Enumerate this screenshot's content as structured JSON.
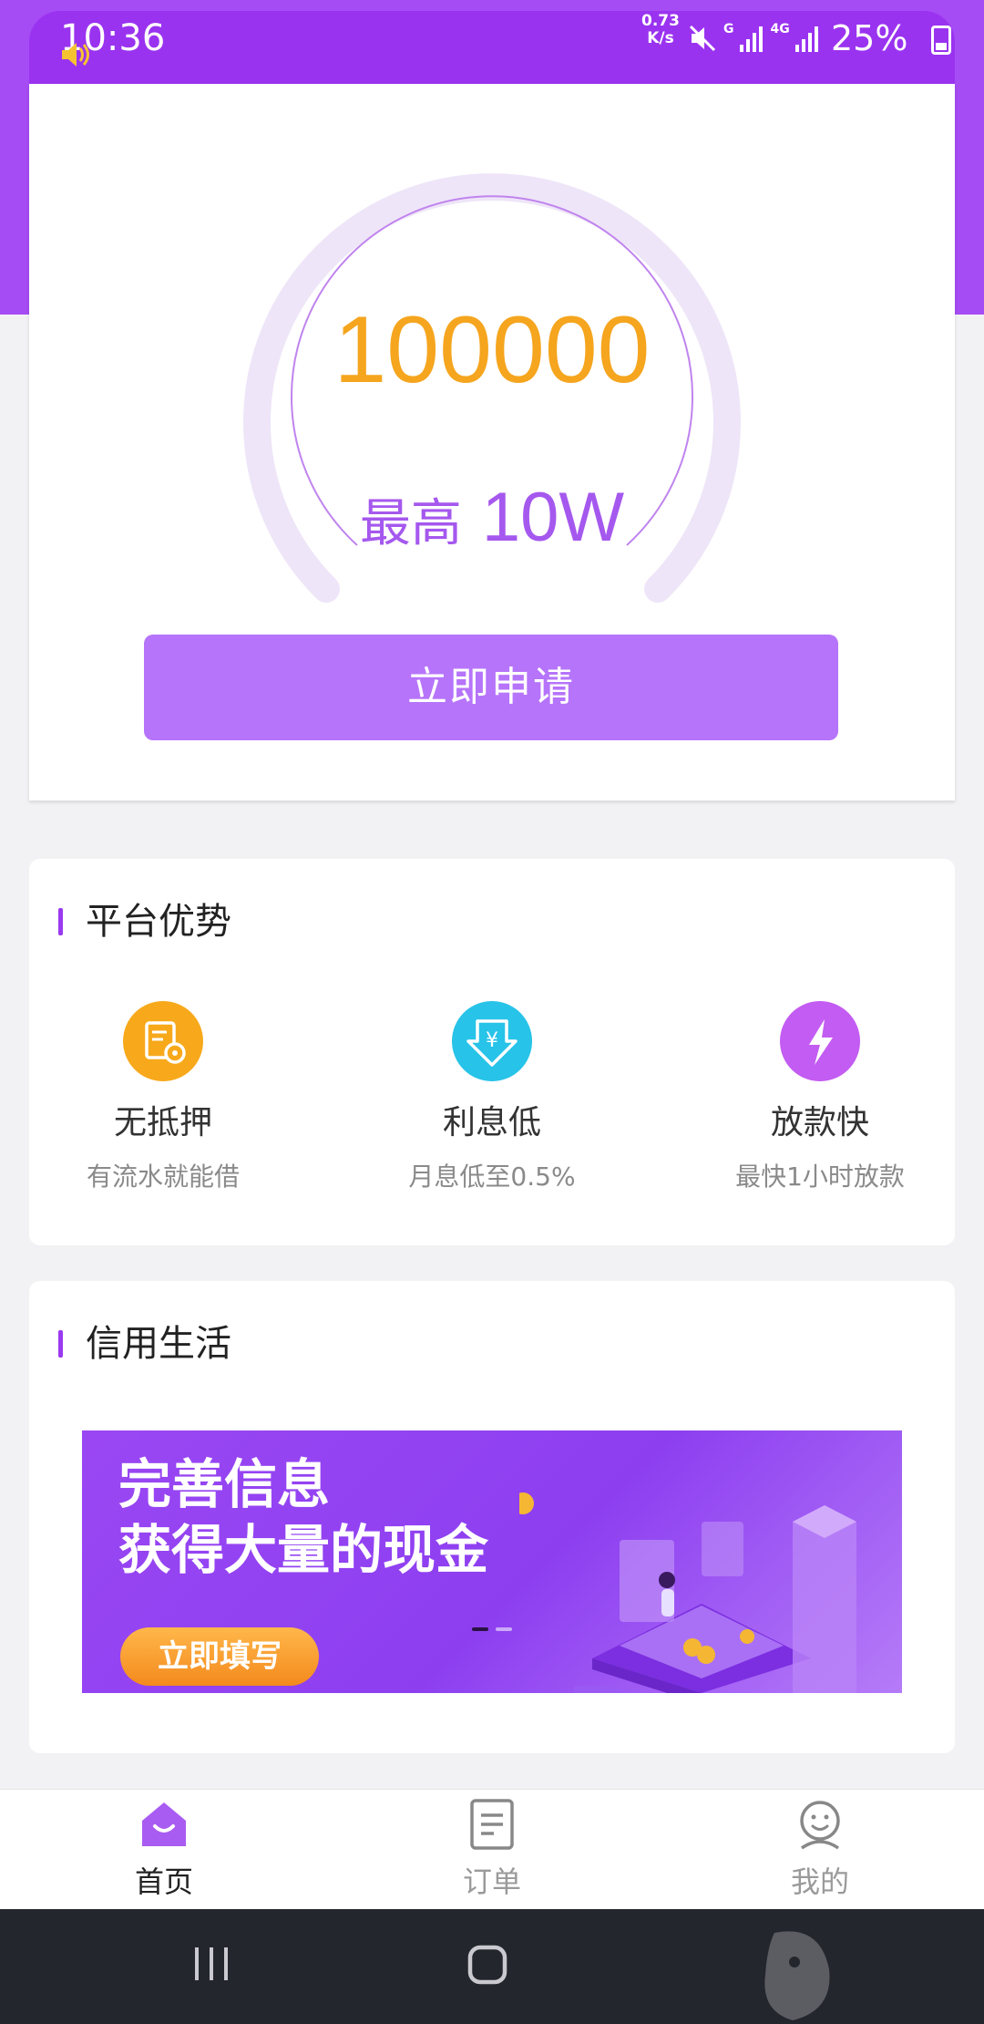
{
  "status_bar": {
    "time": "10:36",
    "net_speed_value": "0.73",
    "net_speed_unit": "K/s",
    "signal1_label": "G",
    "signal2_label": "4G",
    "battery": "25%"
  },
  "hero": {
    "amount": "100000",
    "max_label": "最高",
    "max_value": "10W",
    "apply_button": "立即申请"
  },
  "advantages": {
    "title": "平台优势",
    "items": [
      {
        "title": "无抵押",
        "subtitle": "有流水就能借",
        "icon": "document-seal-icon",
        "color": "#f7a91b"
      },
      {
        "title": "利息低",
        "subtitle": "月息低至0.5%",
        "icon": "yen-down-icon",
        "color": "#27c3e8"
      },
      {
        "title": "放款快",
        "subtitle": "最快1小时放款",
        "icon": "lightning-icon",
        "color": "#c35cf2"
      }
    ]
  },
  "credit_life": {
    "title": "信用生活",
    "banner": {
      "line1": "完善信息",
      "line2": "获得大量的现金",
      "button": "立即填写",
      "active_slide": 1,
      "slide_count": 2
    }
  },
  "bottom_nav": {
    "items": [
      {
        "label": "首页",
        "icon": "home-icon",
        "active": true
      },
      {
        "label": "订单",
        "icon": "order-document-icon",
        "active": false
      },
      {
        "label": "我的",
        "icon": "profile-icon",
        "active": false
      }
    ]
  },
  "colors": {
    "brand_purple": "#9a33f0",
    "button_purple": "#b674fa",
    "amount_orange": "#f5a51e"
  }
}
